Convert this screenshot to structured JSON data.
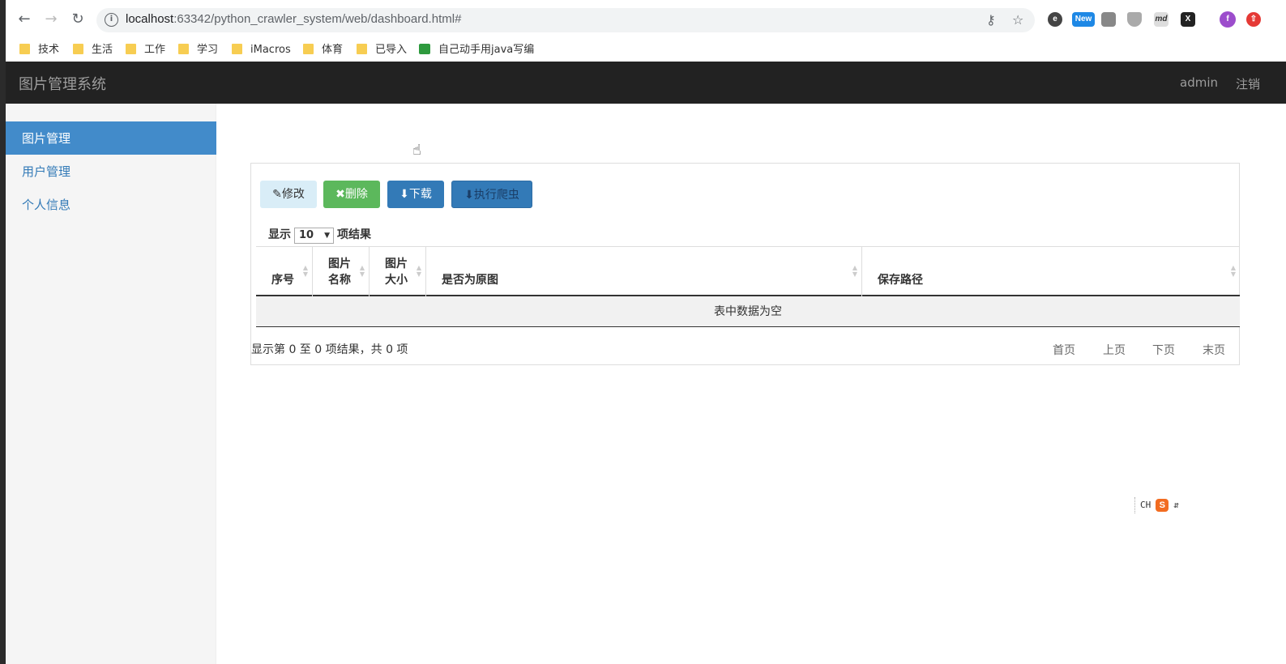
{
  "browser": {
    "url_host": "localhost",
    "url_rest": ":63342/python_crawler_system/web/dashboard.html#",
    "bookmarks": [
      {
        "label": "技术",
        "icon": "folder-icon"
      },
      {
        "label": "生活",
        "icon": "folder-icon"
      },
      {
        "label": "工作",
        "icon": "folder-icon"
      },
      {
        "label": "学习",
        "icon": "folder-icon"
      },
      {
        "label": "iMacros",
        "icon": "folder-icon"
      },
      {
        "label": "体育",
        "icon": "folder-icon"
      },
      {
        "label": "已导入",
        "icon": "folder-icon"
      },
      {
        "label": "自己动手用java写编",
        "icon": "bookmark-page-icon"
      }
    ],
    "extensions": {
      "new_badge": "New",
      "md": "md"
    },
    "profile_initial": "f"
  },
  "app": {
    "brand": "图片管理系统",
    "user": "admin",
    "logout": "注销"
  },
  "sidebar": {
    "items": [
      {
        "label": "图片管理",
        "active": true
      },
      {
        "label": "用户管理",
        "active": false
      },
      {
        "label": "个人信息",
        "active": false
      }
    ]
  },
  "toolbar": {
    "edit": "修改",
    "delete": "删除",
    "download": "下载",
    "crawl": "执行爬虫"
  },
  "length": {
    "prefix": "显示",
    "value": "10",
    "suffix": "项结果"
  },
  "table": {
    "columns": [
      {
        "line1": "序号",
        "line2": ""
      },
      {
        "line1": "图片",
        "line2": "名称"
      },
      {
        "line1": "图片",
        "line2": "大小"
      },
      {
        "line1": "是否为原图",
        "line2": ""
      },
      {
        "line1": "保存路径",
        "line2": ""
      }
    ],
    "empty_text": "表中数据为空"
  },
  "info": "显示第 0 至 0 项结果，共 0 项",
  "pagination": {
    "first": "首页",
    "prev": "上页",
    "next": "下页",
    "last": "末页"
  },
  "ime": {
    "mode": "CH",
    "logo": "S"
  }
}
